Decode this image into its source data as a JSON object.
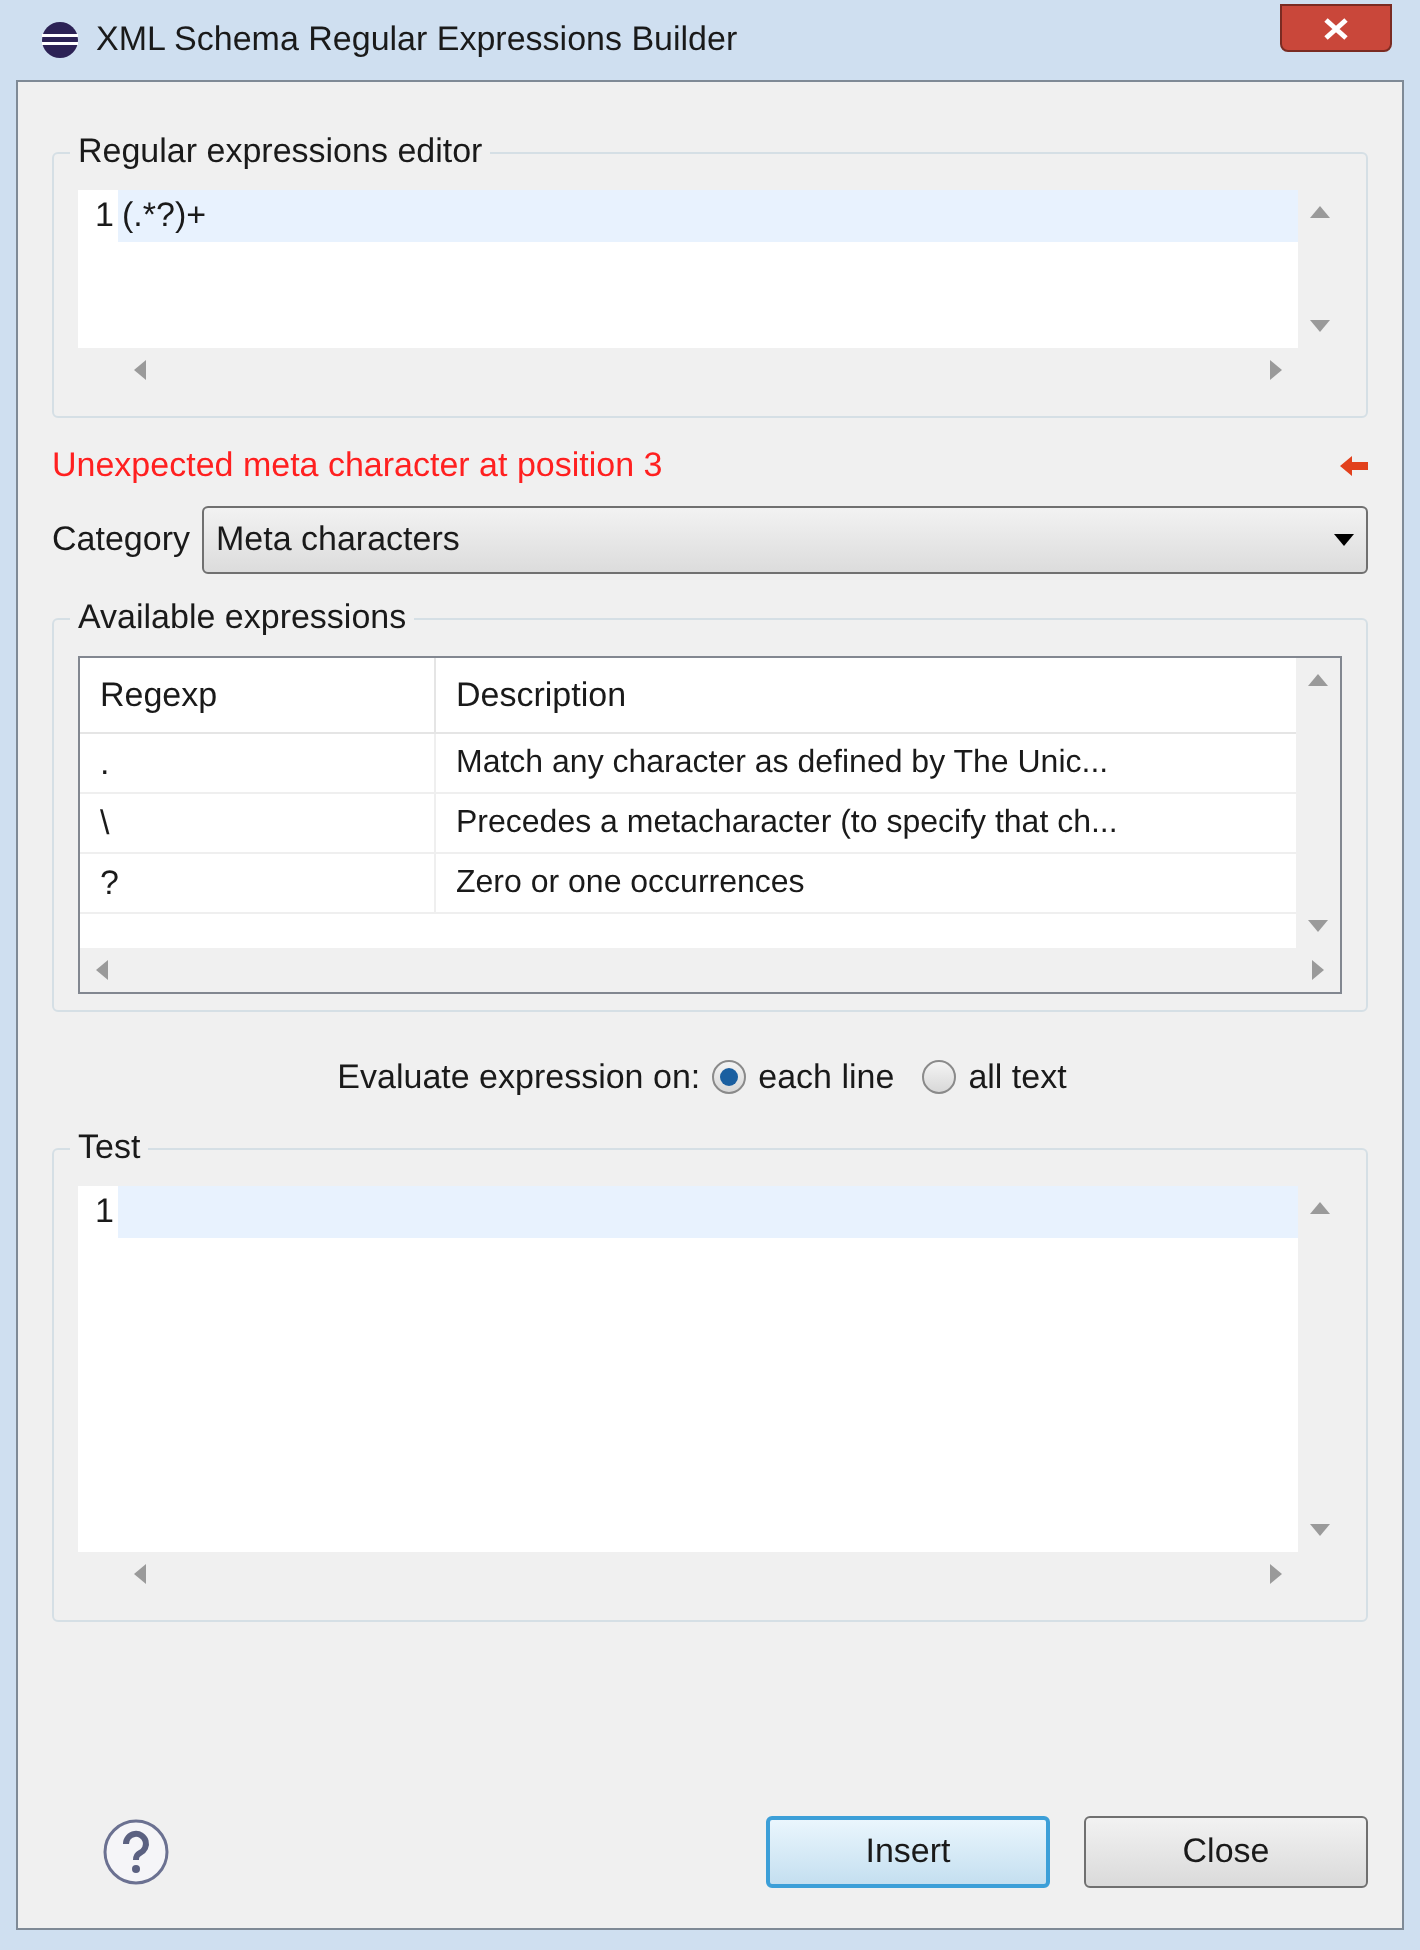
{
  "window": {
    "title": "XML Schema Regular Expressions Builder"
  },
  "editor": {
    "label": "Regular expressions editor",
    "lines": [
      {
        "number": "1",
        "text": "(.*?)+"
      }
    ]
  },
  "error": {
    "message": "Unexpected meta character at position 3"
  },
  "category": {
    "label": "Category",
    "value": "Meta characters"
  },
  "available": {
    "label": "Available expressions",
    "columns": [
      "Regexp",
      "Description"
    ],
    "rows": [
      {
        "regexp": ".",
        "description": "Match any character as defined by The Unic..."
      },
      {
        "regexp": "\\",
        "description": "Precedes a metacharacter (to specify that ch..."
      },
      {
        "regexp": "?",
        "description": "Zero or one occurrences"
      }
    ]
  },
  "evaluate": {
    "label": "Evaluate expression on:",
    "options": [
      {
        "label": "each line",
        "selected": true
      },
      {
        "label": "all text",
        "selected": false
      }
    ]
  },
  "test": {
    "label": "Test",
    "lines": [
      {
        "number": "1"
      }
    ]
  },
  "buttons": [
    {
      "label": "Insert",
      "default": true
    },
    {
      "label": "Close",
      "default": false
    }
  ]
}
